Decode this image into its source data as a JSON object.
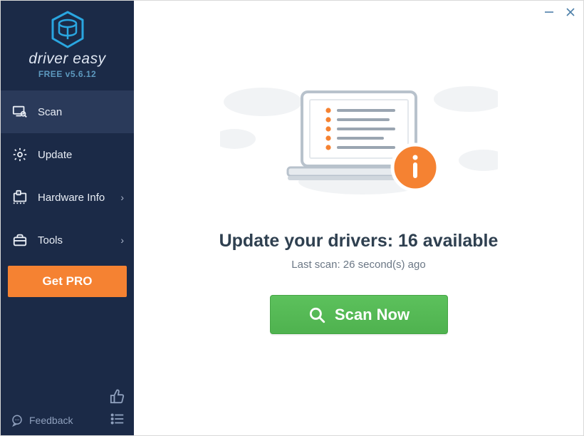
{
  "brand": {
    "name": "driver easy",
    "version": "FREE v5.6.12"
  },
  "sidebar": {
    "items": [
      {
        "label": "Scan"
      },
      {
        "label": "Update"
      },
      {
        "label": "Hardware Info"
      },
      {
        "label": "Tools"
      }
    ],
    "pro_label": "Get PRO",
    "feedback_label": "Feedback"
  },
  "main": {
    "headline": "Update your drivers: 16 available",
    "last_scan": "Last scan: 26 second(s) ago",
    "scan_button": "Scan Now"
  }
}
